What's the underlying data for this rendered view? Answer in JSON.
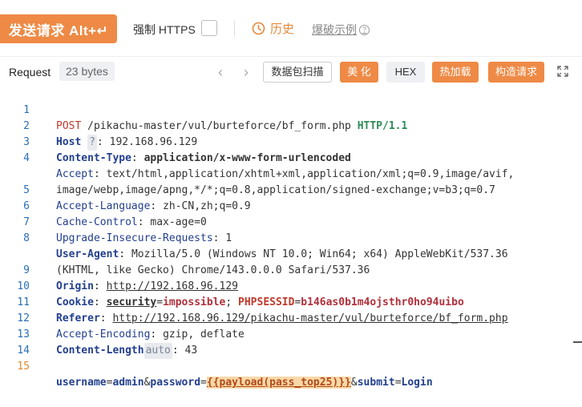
{
  "toolbar": {
    "send_label": "发送请求 Alt+↵",
    "https_label": "强制 HTTPS",
    "history_label": "历史",
    "examples_label": "爆破示例"
  },
  "request_bar": {
    "title": "Request",
    "bytes": "23 bytes",
    "scan_label": "数据包扫描",
    "beautify_label": "美 化",
    "hex_label": "HEX",
    "hotload_label": "热加载",
    "build_label": "构造请求"
  },
  "editor": {
    "line_numbers": [
      "1",
      "2",
      "3",
      "4",
      "",
      "5",
      "6",
      "7",
      "8",
      "",
      "9",
      "10",
      "11",
      "12",
      "13",
      "14",
      "15"
    ],
    "l1": {
      "method": "POST",
      "path": " /pikachu-master/vul/burteforce/bf_form.php ",
      "proto": "HTTP/1.1"
    },
    "l2": {
      "key": "Host",
      "hint": "?",
      "sep": ": ",
      "value": "192.168.96.129"
    },
    "l3": {
      "key": "Content-Type",
      "sep": ": ",
      "value": "application/x-www-form-urlencoded"
    },
    "l4a": {
      "key": "Accept",
      "sep": ": ",
      "value": "text/html,application/xhtml+xml,application/xml;q=0.9,image/avif,"
    },
    "l4b": {
      "value": "image/webp,image/apng,*/*;q=0.8,application/signed-exchange;v=b3;q=0.7"
    },
    "l5": {
      "key": "Accept-Language",
      "sep": ": ",
      "value": "zh-CN,zh;q=0.9"
    },
    "l6": {
      "key": "Cache-Control",
      "sep": ": ",
      "value": "max-age=0"
    },
    "l7": {
      "key": "Upgrade-Insecure-Requests",
      "sep": ": ",
      "value": "1"
    },
    "l8a": {
      "key": "User-Agent",
      "sep": ": ",
      "value": "Mozilla/5.0 (Windows NT 10.0; Win64; x64) AppleWebKit/537.36 "
    },
    "l8b": {
      "value": "(KHTML, like Gecko) Chrome/143.0.0.0 Safari/537.36"
    },
    "l9": {
      "key": "Origin",
      "sep": ": ",
      "value": "http://192.168.96.129"
    },
    "l10": {
      "key": "Cookie",
      "sep": ": ",
      "c1k": "security",
      "c1v": "impossible",
      "semi": "; ",
      "c2k": "PHPSESSID",
      "c2v": "b146as0b1m4ojsthr0ho94uibo",
      "eq": "="
    },
    "l11": {
      "key": "Referer",
      "sep": ": ",
      "value": "http://192.168.96.129/pikachu-master/vul/burteforce/bf_form.php"
    },
    "l12": {
      "key": "Accept-Encoding",
      "sep": ": ",
      "value": "gzip, deflate"
    },
    "l13": {
      "key": "Content-Length",
      "hint": "auto",
      "sep": ": ",
      "value": "43"
    },
    "l15": {
      "k1": "username",
      "eq": "=",
      "v1": "admin",
      "amp": "&",
      "k2": "password",
      "payload": "{{payload(pass_top25)}}",
      "k3": "submit",
      "v3": "Login"
    }
  }
}
